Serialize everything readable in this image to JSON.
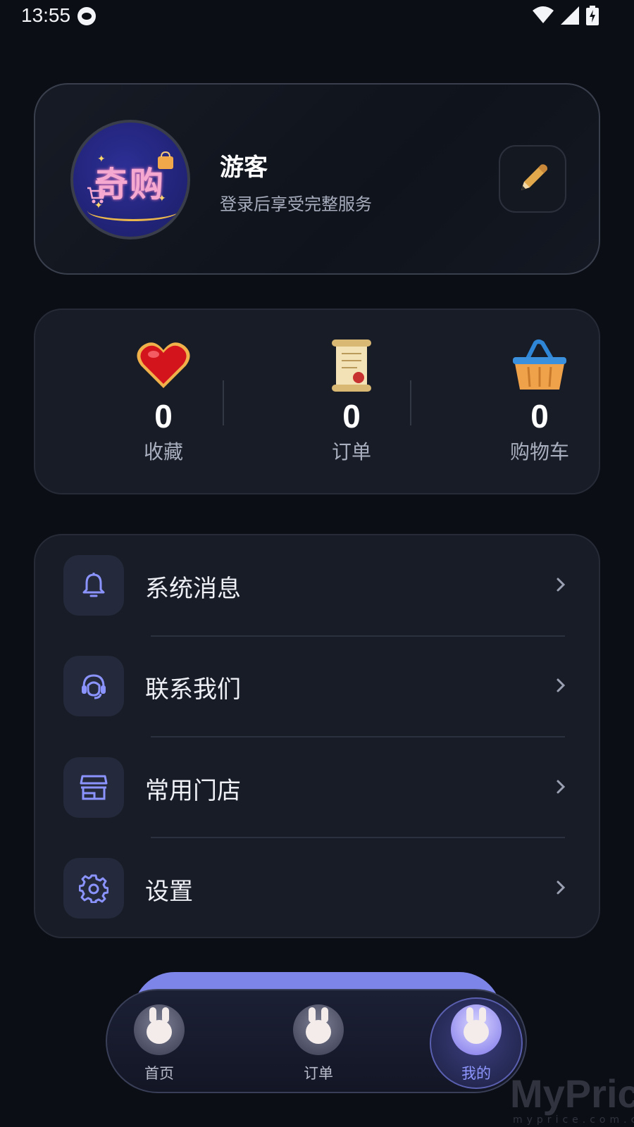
{
  "status_bar": {
    "time": "13:55"
  },
  "profile": {
    "avatar_text": "奇购",
    "name": "游客",
    "subtitle": "登录后享受完整服务"
  },
  "stats": [
    {
      "value": "0",
      "label": "收藏",
      "icon": "heart-icon"
    },
    {
      "value": "0",
      "label": "订单",
      "icon": "scroll-icon"
    },
    {
      "value": "0",
      "label": "购物车",
      "icon": "basket-icon"
    }
  ],
  "menu": [
    {
      "label": "系统消息",
      "icon": "bell-icon"
    },
    {
      "label": "联系我们",
      "icon": "headset-icon"
    },
    {
      "label": "常用门店",
      "icon": "store-icon"
    },
    {
      "label": "设置",
      "icon": "gear-icon"
    }
  ],
  "bottom_nav": [
    {
      "label": "首页",
      "active": false
    },
    {
      "label": "订单",
      "active": false
    },
    {
      "label": "我的",
      "active": true
    }
  ],
  "watermark": {
    "title": "MyPrice",
    "sub": "myprice.com.cn"
  },
  "colors": {
    "accent": "#7d86e8",
    "icon": "#8b93ff",
    "card": "#181c27",
    "background": "#0b0e15"
  }
}
